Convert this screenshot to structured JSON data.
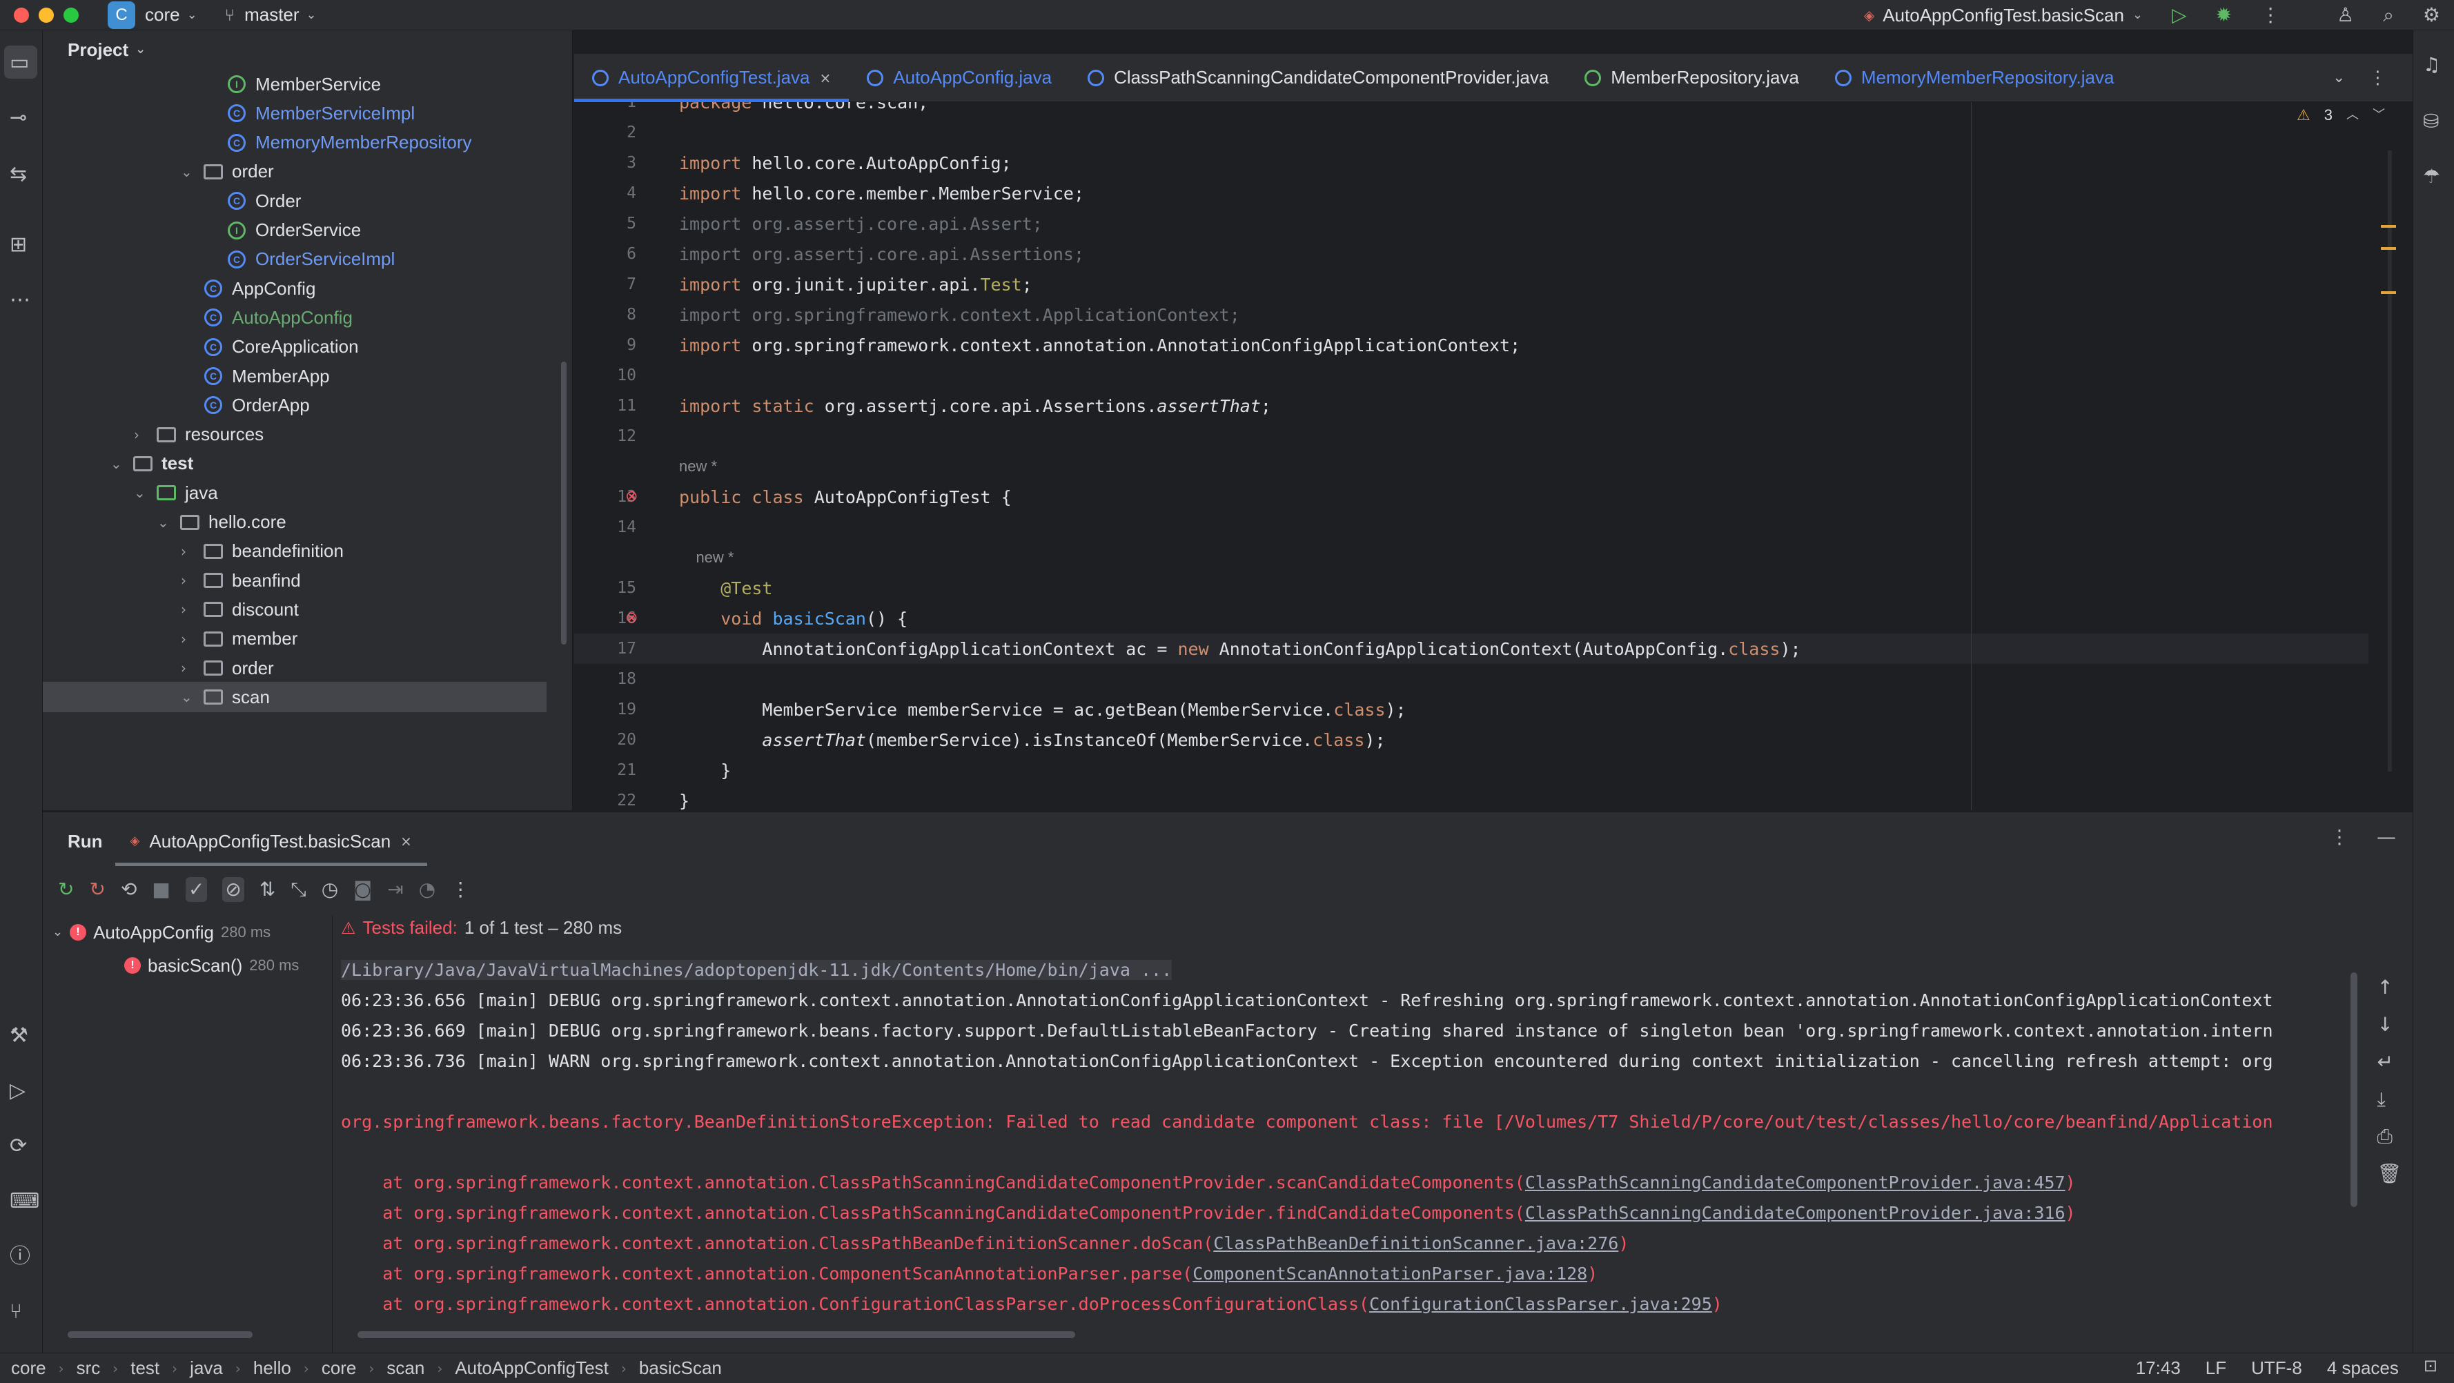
{
  "titlebar": {
    "project": "core",
    "project_initial": "C",
    "branch": "master",
    "run_config": "AutoAppConfigTest.basicScan"
  },
  "project_panel": {
    "title": "Project",
    "rows": [
      {
        "label": "MemberService",
        "kind": "interface",
        "indent": 2,
        "arrow": ""
      },
      {
        "label": "MemberServiceImpl",
        "kind": "class-mod",
        "indent": 2,
        "arrow": ""
      },
      {
        "label": "MemoryMemberRepository",
        "kind": "class-mod",
        "indent": 2,
        "arrow": ""
      },
      {
        "label": "order",
        "kind": "folder",
        "indent": 1,
        "arrow": "open"
      },
      {
        "label": "Order",
        "kind": "class",
        "indent": 2,
        "arrow": ""
      },
      {
        "label": "OrderService",
        "kind": "interface",
        "indent": 2,
        "arrow": ""
      },
      {
        "label": "OrderServiceImpl",
        "kind": "class-mod",
        "indent": 2,
        "arrow": ""
      },
      {
        "label": "AppConfig",
        "kind": "class",
        "indent": 1,
        "arrow": ""
      },
      {
        "label": "AutoAppConfig",
        "kind": "class-new",
        "indent": 1,
        "arrow": ""
      },
      {
        "label": "CoreApplication",
        "kind": "class",
        "indent": 1,
        "arrow": ""
      },
      {
        "label": "MemberApp",
        "kind": "class",
        "indent": 1,
        "arrow": ""
      },
      {
        "label": "OrderApp",
        "kind": "class",
        "indent": 1,
        "arrow": ""
      },
      {
        "label": "resources",
        "kind": "folder",
        "indent": -1,
        "arrow": "closed"
      },
      {
        "label": "test",
        "kind": "folder-bold",
        "indent": -2,
        "arrow": "open"
      },
      {
        "label": "java",
        "kind": "folder-src",
        "indent": -1,
        "arrow": "open"
      },
      {
        "label": "hello.core",
        "kind": "folder",
        "indent": 0,
        "arrow": "open"
      },
      {
        "label": "beandefinition",
        "kind": "folder",
        "indent": 1,
        "arrow": "closed"
      },
      {
        "label": "beanfind",
        "kind": "folder",
        "indent": 1,
        "arrow": "closed"
      },
      {
        "label": "discount",
        "kind": "folder",
        "indent": 1,
        "arrow": "closed"
      },
      {
        "label": "member",
        "kind": "folder",
        "indent": 1,
        "arrow": "closed"
      },
      {
        "label": "order",
        "kind": "folder",
        "indent": 1,
        "arrow": "closed"
      },
      {
        "label": "scan",
        "kind": "folder",
        "indent": 1,
        "arrow": "open"
      }
    ]
  },
  "tabs": [
    {
      "label": "AutoAppConfigTest.java",
      "active": true,
      "kind": "class",
      "color": "#548af7"
    },
    {
      "label": "AutoAppConfig.java",
      "active": false,
      "kind": "class",
      "color": "#548af7"
    },
    {
      "label": "ClassPathScanningCandidateComponentProvider.java",
      "active": false,
      "kind": "class",
      "color": "#dfe1e5"
    },
    {
      "label": "MemberRepository.java",
      "active": false,
      "kind": "interface",
      "color": "#dfe1e5"
    },
    {
      "label": "MemoryMemberRepository.java",
      "active": false,
      "kind": "class",
      "color": "#548af7"
    }
  ],
  "editor": {
    "warnings": "3",
    "lines": [
      {
        "n": "1",
        "html": "package hello.core.scan;"
      },
      {
        "n": "2",
        "html": ""
      },
      {
        "n": "3",
        "html": "import hello.core.AutoAppConfig;"
      },
      {
        "n": "4",
        "html": "import hello.core.member.MemberService;"
      },
      {
        "n": "5",
        "html": "import org.assertj.core.api.Assert;",
        "dim": true
      },
      {
        "n": "6",
        "html": "import org.assertj.core.api.Assertions;",
        "dim": true
      },
      {
        "n": "7",
        "html": "import org.junit.jupiter.api.Test;"
      },
      {
        "n": "8",
        "html": "import org.springframework.context.ApplicationContext;",
        "dim": true
      },
      {
        "n": "9",
        "html": "import org.springframework.context.annotation.AnnotationConfigApplicationContext;"
      },
      {
        "n": "10",
        "html": ""
      },
      {
        "n": "11",
        "html": "import static org.assertj.core.api.Assertions.assertThat;"
      },
      {
        "n": "12",
        "html": ""
      },
      {
        "n": "",
        "html": "new *",
        "hint": true
      },
      {
        "n": "13",
        "html": "public class AutoAppConfigTest {"
      },
      {
        "n": "14",
        "html": ""
      },
      {
        "n": "",
        "html": "    new *",
        "hint": true
      },
      {
        "n": "15",
        "html": "    @Test"
      },
      {
        "n": "16",
        "html": "    void basicScan() {"
      },
      {
        "n": "17",
        "html": "        AnnotationConfigApplicationContext ac = new AnnotationConfigApplicationContext(AutoAppConfig.class);",
        "current": true
      },
      {
        "n": "18",
        "html": ""
      },
      {
        "n": "19",
        "html": "        MemberService memberService = ac.getBean(MemberService.class);"
      },
      {
        "n": "20",
        "html": "        assertThat(memberService).isInstanceOf(MemberService.class);"
      },
      {
        "n": "21",
        "html": "    }"
      },
      {
        "n": "22",
        "html": "}"
      }
    ]
  },
  "run": {
    "title": "Run",
    "tab": "AutoAppConfigTest.basicScan",
    "tree": [
      {
        "label": "AutoAppConfig",
        "time": "280 ms"
      },
      {
        "label": "basicScan()",
        "time": "280 ms"
      }
    ],
    "status": "Tests failed:",
    "status_detail": "1 of 1 test – 280 ms",
    "console": [
      {
        "text": "/Library/Java/JavaVirtualMachines/adoptopenjdk-11.jdk/Contents/Home/bin/java ...",
        "kind": "cmd"
      },
      {
        "text": "06:23:36.656 [main] DEBUG org.springframework.context.annotation.AnnotationConfigApplicationContext - Refreshing org.springframework.context.annotation.AnnotationConfigApplicationContext",
        "kind": "log"
      },
      {
        "text": "06:23:36.669 [main] DEBUG org.springframework.beans.factory.support.DefaultListableBeanFactory - Creating shared instance of singleton bean 'org.springframework.context.annotation.intern",
        "kind": "log"
      },
      {
        "text": "06:23:36.736 [main] WARN org.springframework.context.annotation.AnnotationConfigApplicationContext - Exception encountered during context initialization - cancelling refresh attempt: org",
        "kind": "log"
      },
      {
        "text": "",
        "kind": "blank"
      },
      {
        "text": "org.springframework.beans.factory.BeanDefinitionStoreException: Failed to read candidate component class: file [/Volumes/T7 Shield/P/core/out/test/classes/hello/core/beanfind/Application",
        "kind": "err"
      },
      {
        "text": "",
        "kind": "blank"
      },
      {
        "text": "    at org.springframework.context.annotation.ClassPathScanningCandidateComponentProvider.scanCandidateComponents(",
        "link": "ClassPathScanningCandidateComponentProvider.java:457",
        "kind": "trace"
      },
      {
        "text": "    at org.springframework.context.annotation.ClassPathScanningCandidateComponentProvider.findCandidateComponents(",
        "link": "ClassPathScanningCandidateComponentProvider.java:316",
        "kind": "trace"
      },
      {
        "text": "    at org.springframework.context.annotation.ClassPathBeanDefinitionScanner.doScan(",
        "link": "ClassPathBeanDefinitionScanner.java:276",
        "kind": "trace"
      },
      {
        "text": "    at org.springframework.context.annotation.ComponentScanAnnotationParser.parse(",
        "link": "ComponentScanAnnotationParser.java:128",
        "kind": "trace"
      },
      {
        "text": "    at org.springframework.context.annotation.ConfigurationClassParser.doProcessConfigurationClass(",
        "link": "ConfigurationClassParser.java:295",
        "kind": "trace"
      }
    ]
  },
  "statusbar": {
    "crumbs": [
      "core",
      "src",
      "test",
      "java",
      "hello",
      "core",
      "scan",
      "AutoAppConfigTest",
      "basicScan"
    ],
    "position": "17:43",
    "line_sep": "LF",
    "encoding": "UTF-8",
    "indent": "4 spaces"
  }
}
